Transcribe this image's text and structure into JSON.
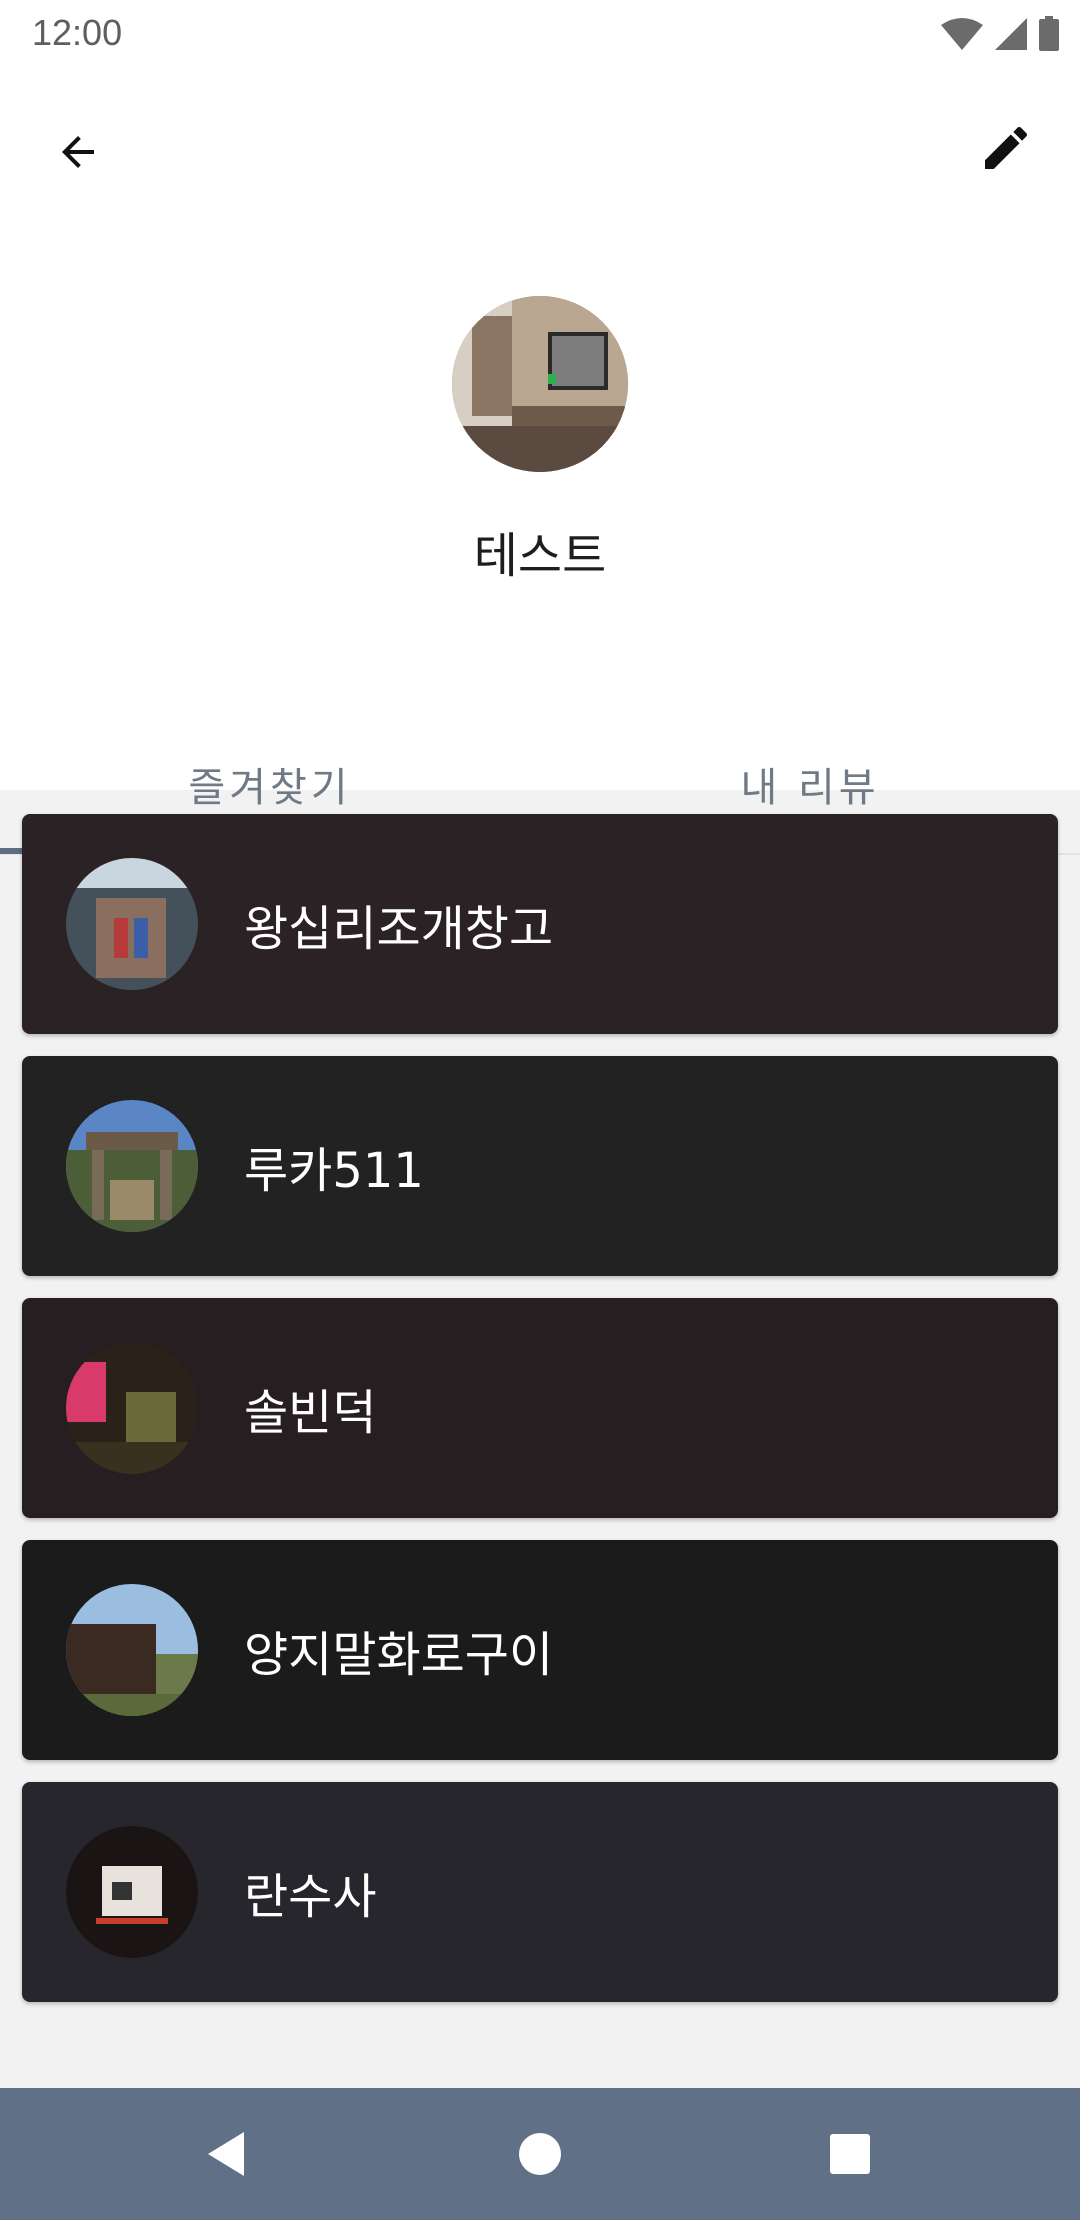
{
  "status_bar": {
    "time": "12:00",
    "icons": [
      "wifi-icon",
      "cell-signal-icon",
      "battery-icon"
    ]
  },
  "header": {
    "back_icon": "arrow-back-icon",
    "edit_icon": "pencil-icon",
    "username": "테스트"
  },
  "tabs": [
    {
      "label": "즐겨찾기",
      "selected": true
    },
    {
      "label": "내 리뷰",
      "selected": false
    }
  ],
  "favorites": [
    {
      "name": "왕십리조개창고",
      "bg": "#2a2224"
    },
    {
      "name": "루카511",
      "bg": "#222223"
    },
    {
      "name": "솔빈덕",
      "bg": "#261e20"
    },
    {
      "name": "양지말화로구이",
      "bg": "#1b1b1c"
    },
    {
      "name": "란수사",
      "bg": "#27262d"
    }
  ],
  "colors": {
    "accent": "#5f6d80",
    "navbar": "#607086"
  },
  "nav_bar": {
    "icons": [
      "back-triangle-icon",
      "home-circle-icon",
      "recents-square-icon"
    ]
  }
}
